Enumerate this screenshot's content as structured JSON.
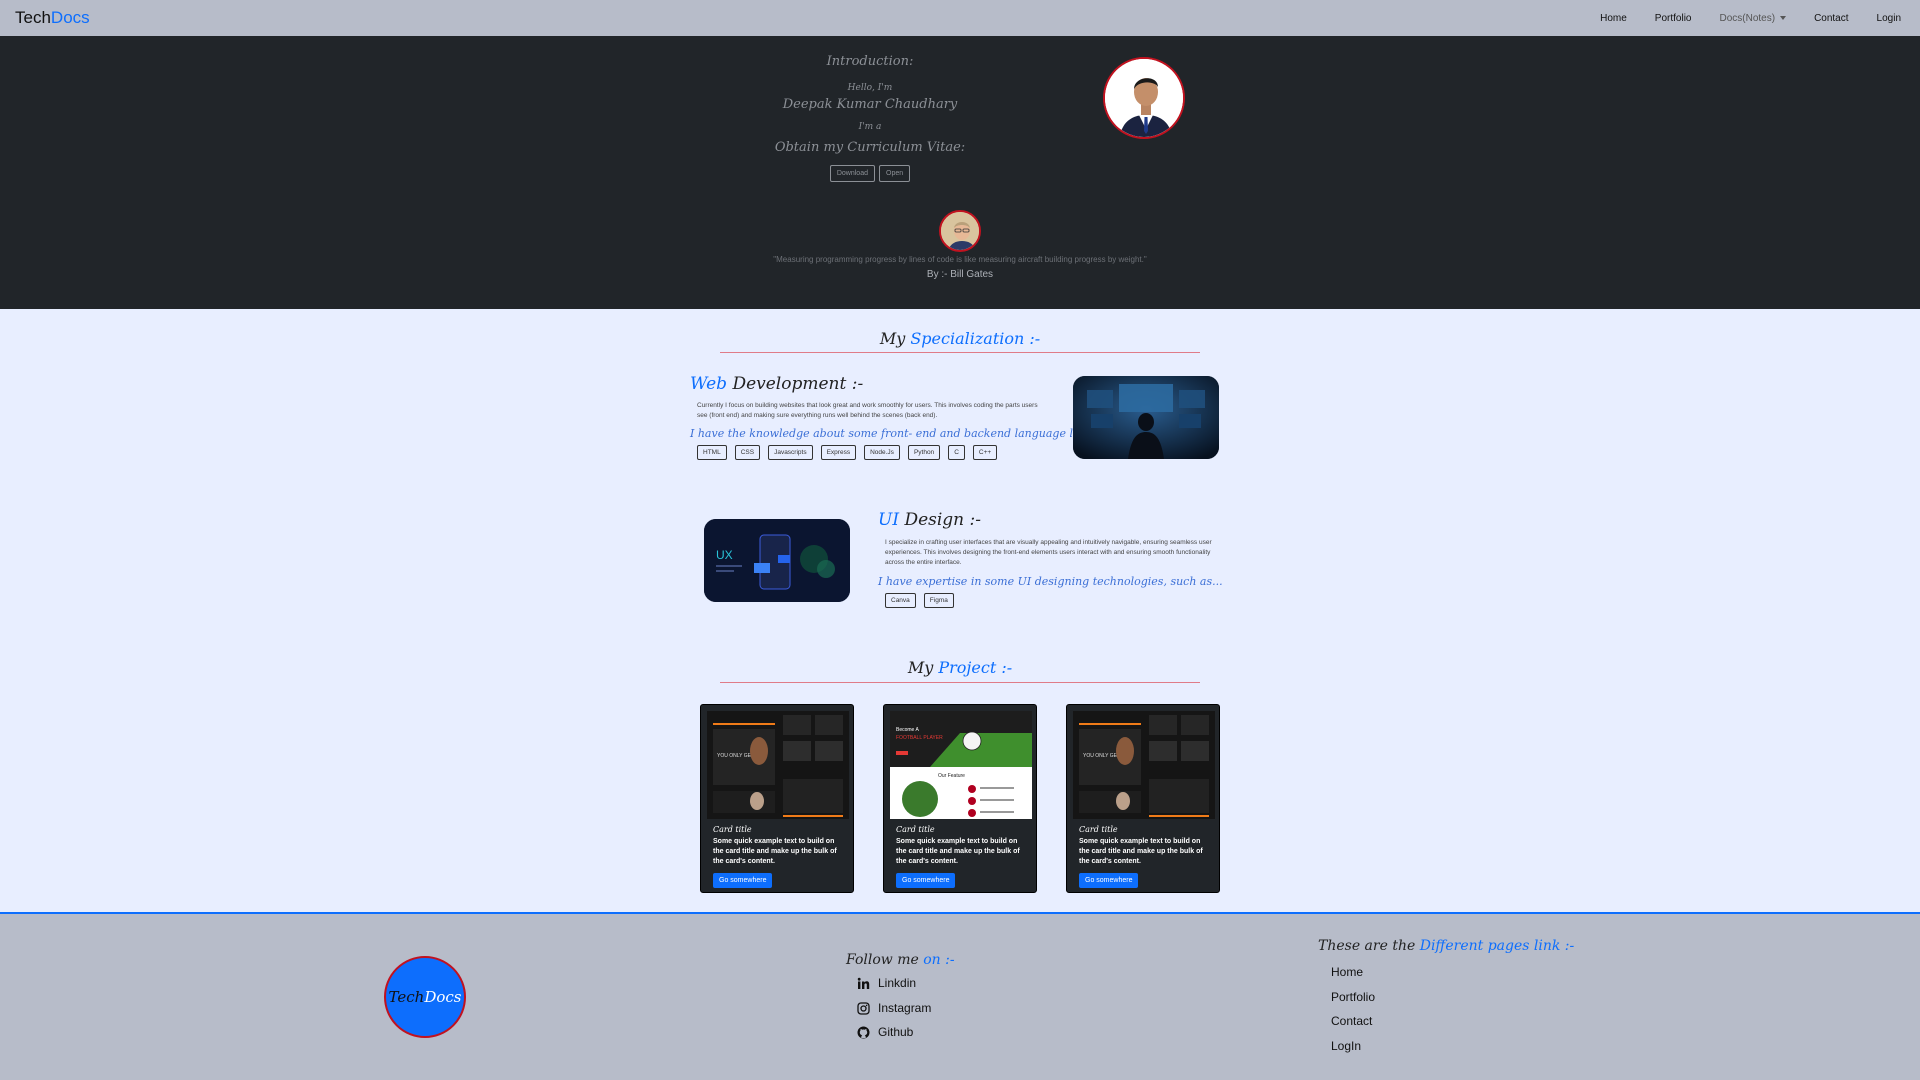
{
  "navbar": {
    "brand_part1": "Tech",
    "brand_part2": "Docs",
    "links": [
      "Home",
      "Portfolio",
      "Docs(Notes)",
      "Contact",
      "Login"
    ]
  },
  "hero": {
    "introduction": "Introduction:",
    "hello": "Hello, I'm",
    "name": "Deepak Kumar Chaudhary",
    "im_a": "I'm a",
    "cv_heading": "Obtain my Curriculum Vitae:",
    "download_label": "Download",
    "open_label": "Open",
    "quote": "\"Measuring programming progress by lines of code is like measuring aircraft building progress by weight.\"",
    "quote_by": "By :- Bill Gates"
  },
  "specialization": {
    "title_part1": "My",
    "title_part2": "Specialization :-",
    "web": {
      "title_part1": "Web",
      "title_part2": "Development :-",
      "desc": "Currently I focus on building websites that look great and work smoothly for users. This involves coding the parts users see (front end) and making sure everything runs well behind the scenes (back end).",
      "tagline": "I have the knowledge about some front- end and backend language like...",
      "chips": [
        "HTML",
        "CSS",
        "Javascripts",
        "Express",
        "Node.Js",
        "Python",
        "C",
        "C++"
      ]
    },
    "ui": {
      "title_part1": "UI",
      "title_part2": "Design :-",
      "desc": "I specialize in crafting user interfaces that are visually appealing and intuitively navigable, ensuring seamless user experiences. This involves designing the front-end elements users interact with and ensuring smooth functionality across the entire interface.",
      "tagline": "I have expertise in some UI designing technologies, such as...",
      "chips": [
        "Canva",
        "Figma"
      ]
    }
  },
  "projects": {
    "title_part1": "My",
    "title_part2": "Project :-",
    "cards": [
      {
        "title": "Card title",
        "text": "Some quick example text to build on the card title and make up the bulk of the card's content.",
        "button": "Go somewhere"
      },
      {
        "title": "Card title",
        "text": "Some quick example text to build on the card title and make up the bulk of the card's content.",
        "button": "Go somewhere"
      },
      {
        "title": "Card title",
        "text": "Some quick example text to build on the card title and make up the bulk of the card's content.",
        "button": "Go somewhere"
      }
    ]
  },
  "footer": {
    "logo_part1": "Tech",
    "logo_part2": "Docs",
    "follow_part1": "Follow me",
    "follow_part2": "on :-",
    "social": [
      "Linkdin",
      "Instagram",
      "Github"
    ],
    "pages_part1": "These are the",
    "pages_part2": "Different pages link :-",
    "links": [
      "Home",
      "Portfolio",
      "Contact",
      "LogIn"
    ]
  },
  "colors": {
    "accent": "#0d6efd",
    "dark": "#212529",
    "nav_bg": "#b7bcc9",
    "page_bg": "#e8eeff",
    "avatar_ring": "#c1121f"
  }
}
